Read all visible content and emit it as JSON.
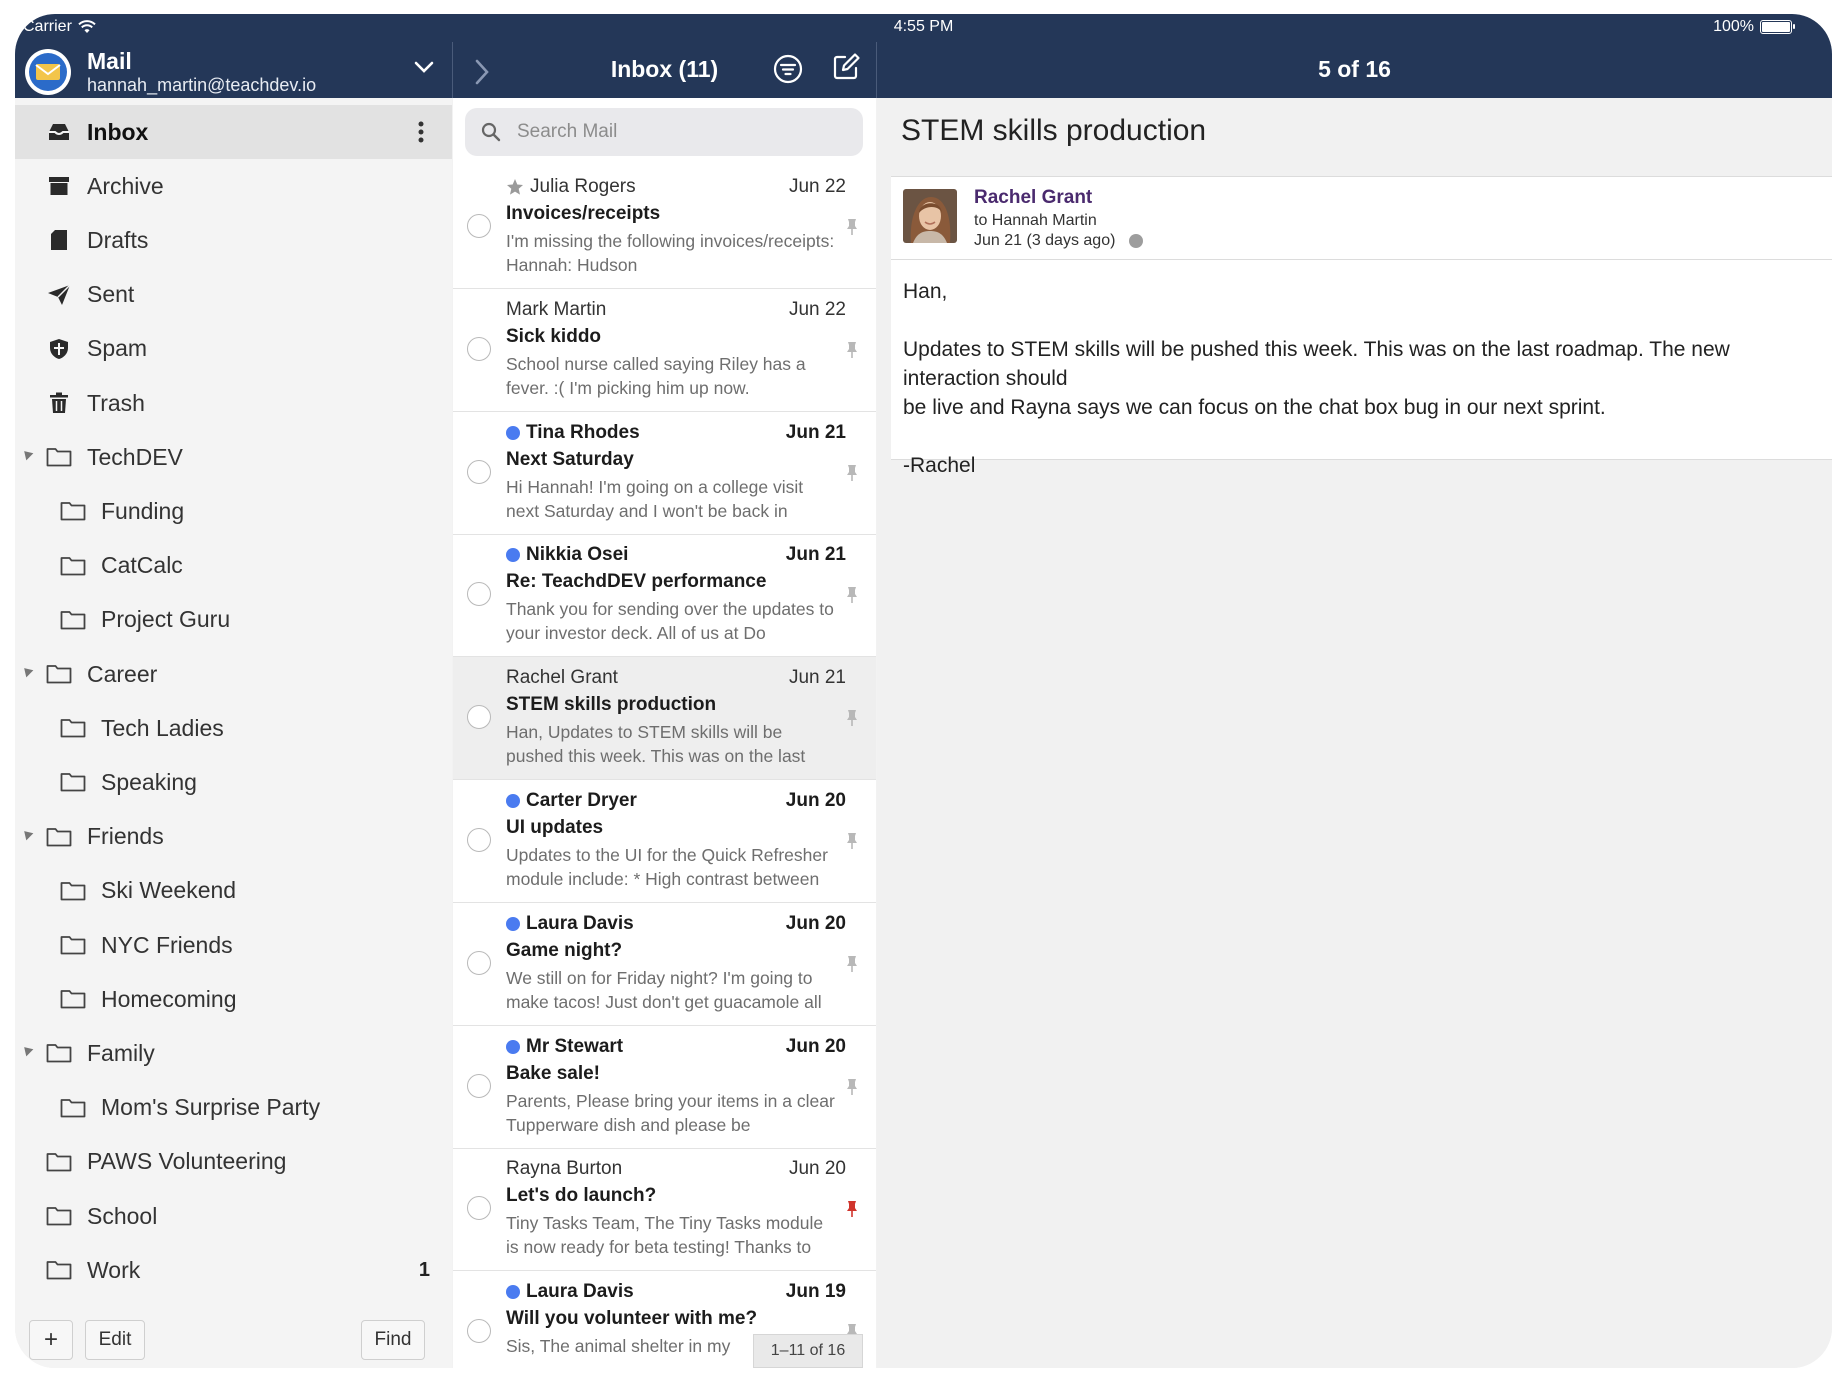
{
  "status_bar": {
    "carrier": "Carrier",
    "time": "4:55 PM",
    "battery": "100%",
    "battery_level": 1.0
  },
  "account": {
    "title": "Mail",
    "email": "hannah_martin@teachdev.io"
  },
  "list_header": {
    "title": "Inbox (11)"
  },
  "reader_header": {
    "counter": "5 of 16"
  },
  "sidebar": {
    "folders": [
      {
        "label": "Inbox",
        "icon": "inbox-icon",
        "level": 0,
        "selected": true,
        "menu": true
      },
      {
        "label": "Archive",
        "icon": "archive-icon",
        "level": 0
      },
      {
        "label": "Drafts",
        "icon": "drafts-icon",
        "level": 0
      },
      {
        "label": "Sent",
        "icon": "paper-plane-icon",
        "level": 0
      },
      {
        "label": "Spam",
        "icon": "shield-icon",
        "level": 0
      },
      {
        "label": "Trash",
        "icon": "trash-icon",
        "level": 0
      },
      {
        "label": "TechDEV",
        "icon": "folder-icon",
        "level": 0,
        "expanded": true
      },
      {
        "label": "Funding",
        "icon": "folder-icon",
        "level": 1
      },
      {
        "label": "CatCalc",
        "icon": "folder-icon",
        "level": 1
      },
      {
        "label": "Project Guru",
        "icon": "folder-icon",
        "level": 1
      },
      {
        "label": "Career",
        "icon": "folder-icon",
        "level": 0,
        "expanded": true
      },
      {
        "label": "Tech Ladies",
        "icon": "folder-icon",
        "level": 1
      },
      {
        "label": "Speaking",
        "icon": "folder-icon",
        "level": 1
      },
      {
        "label": "Friends",
        "icon": "folder-icon",
        "level": 0,
        "expanded": true
      },
      {
        "label": "Ski Weekend",
        "icon": "folder-icon",
        "level": 1
      },
      {
        "label": "NYC Friends",
        "icon": "folder-icon",
        "level": 1
      },
      {
        "label": "Homecoming",
        "icon": "folder-icon",
        "level": 1
      },
      {
        "label": "Family",
        "icon": "folder-icon",
        "level": 0,
        "expanded": true
      },
      {
        "label": "Mom's Surprise Party",
        "icon": "folder-icon",
        "level": 1
      },
      {
        "label": "PAWS Volunteering",
        "icon": "folder-icon",
        "level": 0
      },
      {
        "label": "School",
        "icon": "folder-icon",
        "level": 0
      },
      {
        "label": "Work",
        "icon": "folder-icon",
        "level": 0,
        "badge": "1"
      }
    ],
    "footer": {
      "add_label": "+",
      "edit_label": "Edit",
      "find_label": "Find"
    }
  },
  "search": {
    "placeholder": "Search Mail"
  },
  "messages": [
    {
      "from": "Julia Rogers",
      "date": "Jun 22",
      "subject": "Invoices/receipts",
      "preview": "I'm missing the following invoices/receipts: Hannah: Hudson",
      "unread": false,
      "starred": true,
      "pin_color": "#b8b8b8"
    },
    {
      "from": "Mark Martin",
      "date": "Jun 22",
      "subject": "Sick kiddo",
      "preview": "School nurse called saying Riley has a fever. :( I'm picking him up now.",
      "unread": false,
      "pin_color": "#b8b8b8"
    },
    {
      "from": "Tina Rhodes",
      "date": "Jun 21",
      "subject": "Next Saturday",
      "preview": "Hi Hannah! I'm going on a college visit next Saturday and I won't be back in",
      "unread": true,
      "pin_color": "#b8b8b8"
    },
    {
      "from": "Nikkia Osei",
      "date": "Jun 21",
      "subject": "Re: TeachdDEV performance",
      "preview": "Thank you for sending over the updates to your investor deck. All of us at Do",
      "unread": true,
      "pin_color": "#b8b8b8"
    },
    {
      "from": "Rachel Grant",
      "date": "Jun 21",
      "subject": "STEM skills production",
      "preview": "Han, Updates to STEM skills will be pushed this week. This was on the last",
      "unread": false,
      "selected": true,
      "pin_color": "#b8b8b8"
    },
    {
      "from": "Carter Dryer",
      "date": "Jun 20",
      "subject": "UI updates",
      "preview": "Updates to the UI for the Quick Refresher module include: * High contrast between",
      "unread": true,
      "pin_color": "#b8b8b8"
    },
    {
      "from": "Laura Davis",
      "date": "Jun 20",
      "subject": "Game night?",
      "preview": "We still on for Friday night? I'm going to make tacos! Just don't get guacamole all",
      "unread": true,
      "pin_color": "#b8b8b8"
    },
    {
      "from": "Mr Stewart",
      "date": "Jun 20",
      "subject": "Bake sale!",
      "preview": "Parents, Please bring your items in a clear Tupperware dish and please be",
      "unread": true,
      "pin_color": "#b8b8b8"
    },
    {
      "from": "Rayna Burton",
      "date": "Jun 20",
      "subject": "Let's do launch?",
      "preview": "Tiny Tasks Team, The Tiny Tasks module is now ready for beta testing! Thanks to",
      "unread": false,
      "pin_color": "#d0342c"
    },
    {
      "from": "Laura Davis",
      "date": "Jun 19",
      "subject": "Will you volunteer with me?",
      "preview": "Sis, The animal shelter in my",
      "unread": true,
      "pin_color": "#b8b8b8"
    }
  ],
  "pager": {
    "label": "1–11 of 16"
  },
  "reader": {
    "subject": "STEM skills production",
    "sender": "Rachel Grant",
    "to": "to Hannah Martin",
    "date": "Jun 21 (3 days ago)",
    "body": "Han,\n\nUpdates to STEM skills will be pushed this week. This was on the last roadmap. The new interaction should\nbe live and Rayna says we can focus on the chat box bug in our next sprint.\n\n-Rachel"
  },
  "colors": {
    "header_bg": "#243758",
    "unread_dot": "#4a7bf0",
    "sender_name": "#4a2a6e"
  }
}
